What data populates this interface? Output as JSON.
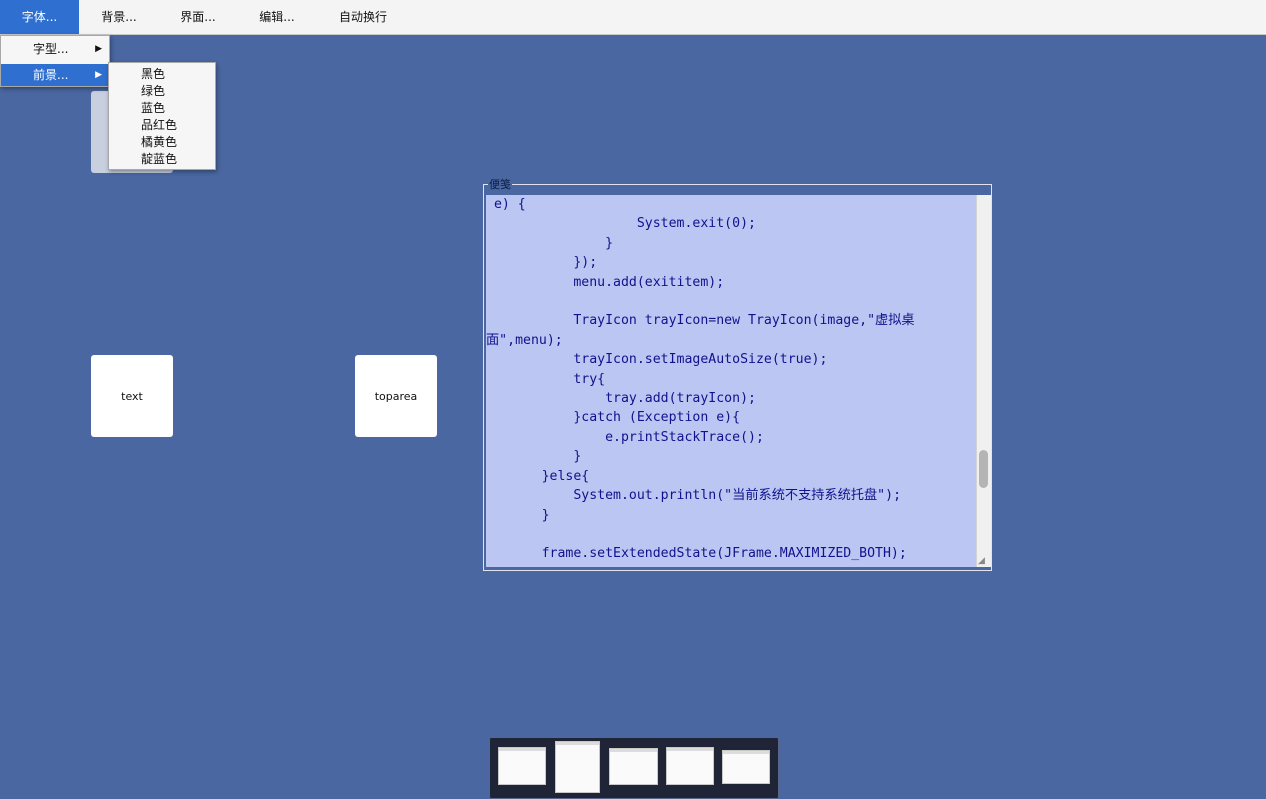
{
  "menubar": {
    "items": [
      {
        "label": "字体...",
        "active": true
      },
      {
        "label": "背景...",
        "active": false
      },
      {
        "label": "界面...",
        "active": false
      },
      {
        "label": "编辑...",
        "active": false
      },
      {
        "label": "自动换行",
        "active": false
      }
    ]
  },
  "font_menu": {
    "items": [
      {
        "label": "字型...",
        "has_submenu": true,
        "active": false
      },
      {
        "label": "前景...",
        "has_submenu": true,
        "active": true
      }
    ]
  },
  "foreground_submenu": {
    "items": [
      "黑色",
      "绿色",
      "蓝色",
      "品红色",
      "橘黄色",
      "靛蓝色"
    ]
  },
  "tiles": {
    "text": "text",
    "toparea": "toparea"
  },
  "notepad": {
    "title": "便笺",
    "code": " e) {\n                   System.exit(0);\n               }\n           });\n           menu.add(exititem);\n\n           TrayIcon trayIcon=new TrayIcon(image,\"虚拟桌\n面\",menu);\n           trayIcon.setImageAutoSize(true);\n           try{\n               tray.add(trayIcon);\n           }catch (Exception e){\n               e.printStackTrace();\n           }\n       }else{\n           System.out.println(\"当前系统不支持系统托盘\");\n       }\n\n       frame.setExtendedState(JFrame.MAXIMIZED_BOTH);"
  },
  "colors": {
    "desktop_background": "#4a67a1",
    "menu_highlight": "#2f6fd0",
    "code_background": "#bbc6f2",
    "code_text": "#10138c"
  }
}
